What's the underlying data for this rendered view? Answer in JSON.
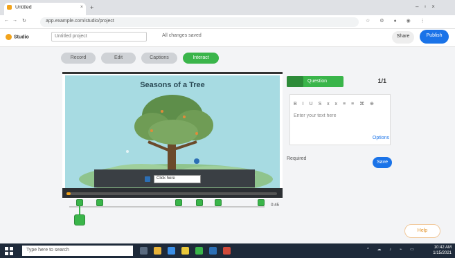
{
  "browser": {
    "tab_title": "Untitled",
    "url": "app.example.com/studio/project"
  },
  "app": {
    "logo_text": "Studio",
    "project_title": "Untitled project",
    "saved_status": "All changes saved",
    "preview_label": "Share",
    "share_label": "Publish"
  },
  "tool_tabs": [
    {
      "label": "Record"
    },
    {
      "label": "Edit"
    },
    {
      "label": "Captions"
    },
    {
      "label": "Interact"
    }
  ],
  "canvas": {
    "scene_title": "Seasons of a Tree",
    "caption_text": "Click here"
  },
  "timeline": {
    "progress_fraction": 0.02,
    "duration": "0:45"
  },
  "panel": {
    "green_label": "Question",
    "counter": "1/1",
    "editor_toolbar": "B I U S x x ≡ ≡ ⌘ ⊕",
    "editor_placeholder": "Enter your text here",
    "editor_link": "Options",
    "toggle_label": "Required",
    "apply_label": "Save",
    "secondary_button": "Help"
  },
  "taskbar": {
    "search_placeholder": "Type here to search",
    "time": "10:42 AM",
    "date": "1/15/2021"
  },
  "colors": {
    "accent_green": "#3ab54a",
    "accent_blue": "#1a73e8",
    "accent_orange": "#f2a31b",
    "sky": "#a7dbe2"
  }
}
